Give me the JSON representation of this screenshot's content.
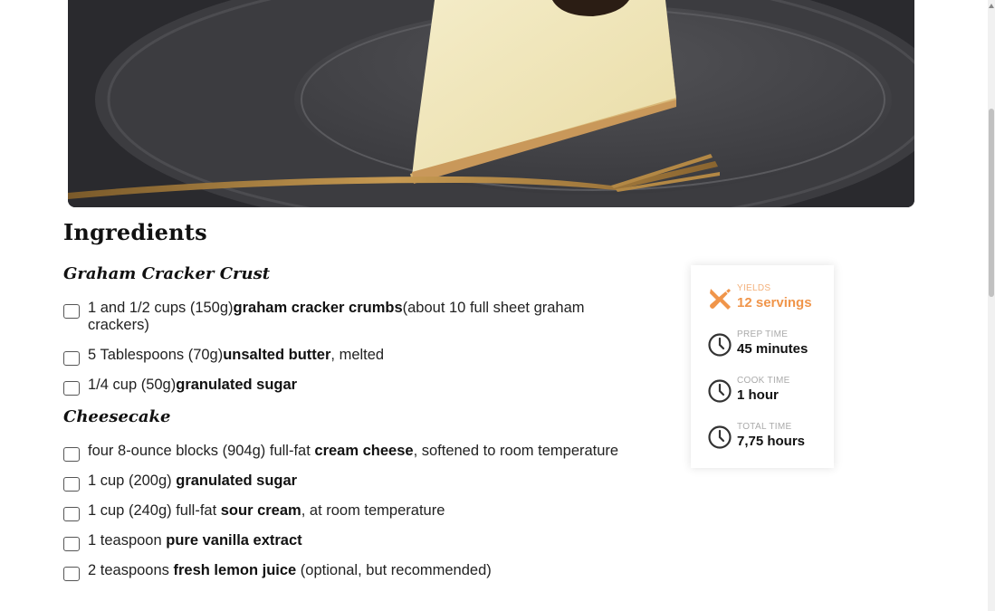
{
  "hero": {
    "image": "cheesecake-slice-photo"
  },
  "ingredients": {
    "title": "Ingredients",
    "groups": [
      {
        "title": "Graham Cracker Crust",
        "items": [
          {
            "pre": "1 and 1/2 cups (150g)",
            "bold": "graham cracker crumbs",
            "post": "(about 10 full sheet graham crackers)"
          },
          {
            "pre": "5 Tablespoons (70g)",
            "bold": "unsalted butter",
            "post": ", melted"
          },
          {
            "pre": "1/4 cup (50g)",
            "bold": "granulated sugar",
            "post": ""
          }
        ]
      },
      {
        "title": "Cheesecake",
        "items": [
          {
            "pre": "four 8-ounce blocks (904g) full-fat ",
            "bold": "cream cheese",
            "post": ", softened to room temperature"
          },
          {
            "pre": "1 cup (200g) ",
            "bold": "granulated sugar",
            "post": ""
          },
          {
            "pre": "1 cup (240g) full-fat ",
            "bold": "sour cream",
            "post": ", at room temperature"
          },
          {
            "pre": "1 teaspoon ",
            "bold": "pure vanilla extract",
            "post": ""
          },
          {
            "pre": "2 teaspoons ",
            "bold": "fresh lemon juice",
            "post": " (optional, but recommended)"
          }
        ]
      }
    ]
  },
  "info": {
    "yields": {
      "label": "YIELDS",
      "value": "12 servings",
      "icon": "utensils-icon"
    },
    "prep": {
      "label": "PREP TIME",
      "value": "45 minutes",
      "icon": "clock-icon"
    },
    "cook": {
      "label": "COOK TIME",
      "value": "1 hour",
      "icon": "clock-icon"
    },
    "total": {
      "label": "TOTAL TIME",
      "value": "7,75 hours",
      "icon": "clock-icon"
    }
  },
  "colors": {
    "accent": "#f0954a",
    "label_gray": "#aaaaaa"
  }
}
